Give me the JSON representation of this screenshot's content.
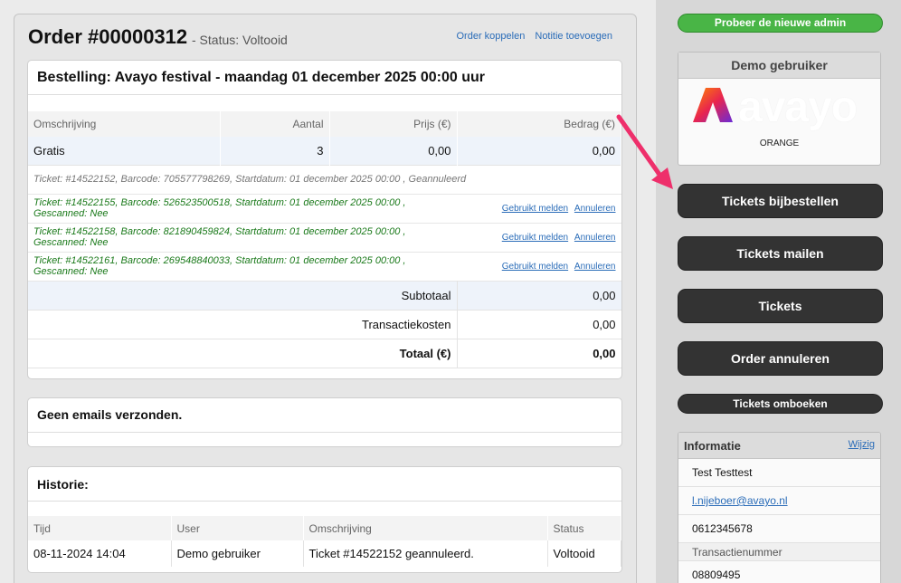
{
  "order": {
    "title": "Order #00000312",
    "status": "- Status: Voltooid",
    "links": [
      "Order koppelen",
      "Notitie toevoegen"
    ]
  },
  "booking": {
    "title": "Bestelling: Avayo festival - maandag 01 december 2025 00:00 uur",
    "columns": [
      "Omschrijving",
      "Aantal",
      "Prijs (€)",
      "Bedrag (€)"
    ],
    "line": {
      "description": "Gratis",
      "quantity": "3",
      "price": "0,00",
      "amount": "0,00"
    },
    "tickets": [
      {
        "text": "Ticket: #14522152, Barcode: 705577798269, Startdatum: 01 december 2025 00:00 , Geannuleerd",
        "state": "cancelled"
      },
      {
        "text": "Ticket: #14522155, Barcode: 526523500518, Startdatum: 01 december 2025 00:00 , Gescanned: Nee",
        "state": "active",
        "actions": [
          "Gebruikt melden",
          "Annuleren"
        ]
      },
      {
        "text": "Ticket: #14522158, Barcode: 821890459824, Startdatum: 01 december 2025 00:00 , Gescanned: Nee",
        "state": "active",
        "actions": [
          "Gebruikt melden",
          "Annuleren"
        ]
      },
      {
        "text": "Ticket: #14522161, Barcode: 269548840033, Startdatum: 01 december 2025 00:00 , Gescanned: Nee",
        "state": "active",
        "actions": [
          "Gebruikt melden",
          "Annuleren"
        ]
      }
    ],
    "subtotal_label": "Subtotaal",
    "subtotal": "0,00",
    "fees_label": "Transactiekosten",
    "fees": "0,00",
    "total_label": "Totaal (€)",
    "total": "0,00"
  },
  "emails": {
    "title": "Geen emails verzonden."
  },
  "history": {
    "title": "Historie:",
    "columns": [
      "Tijd",
      "User",
      "Omschrijving",
      "Status"
    ],
    "rows": [
      {
        "time": "08-11-2024 14:04",
        "user": "Demo gebruiker",
        "description": "Ticket #14522152 geannuleerd.",
        "status": "Voltooid"
      }
    ]
  },
  "sidebar": {
    "new_admin": "Probeer de nieuwe admin",
    "demo_title": "Demo gebruiker",
    "logo_text": "avayo",
    "org_name": "ORANGE",
    "buttons": [
      "Tickets bijbestellen",
      "Tickets mailen",
      "Tickets",
      "Order annuleren",
      "Tickets omboeken"
    ],
    "info": {
      "title": "Informatie",
      "edit": "Wijzig",
      "name": "Test Testtest",
      "email": "l.nijeboer@avayo.nl",
      "phone": "0612345678",
      "transaction_label": "Transactienummer",
      "transaction": "08809495"
    }
  },
  "colors": {
    "accent_link": "#2a6cb8",
    "green_button": "#49b546",
    "dark_button": "#333333",
    "active_ticket": "#1b7a1b",
    "arrow": "#ee2f6b"
  }
}
